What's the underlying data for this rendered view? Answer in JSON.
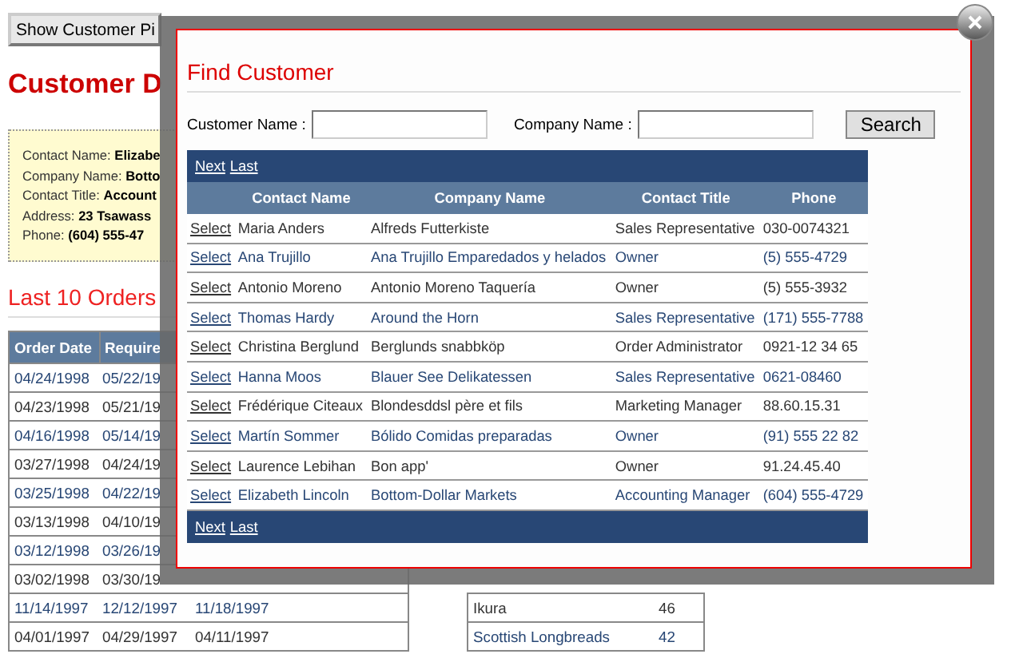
{
  "page": {
    "show_button": "Show Customer Pi",
    "heading": "Customer D",
    "details": [
      {
        "label": "Contact Name:",
        "value": "Elizabe"
      },
      {
        "label": "Company Name:",
        "value": "Botto"
      },
      {
        "label": "Contact Title:",
        "value": "Account"
      },
      {
        "label": "Address:",
        "value": "23 Tsawass"
      },
      {
        "label": "Phone:",
        "value": "(604) 555-47"
      }
    ],
    "orders_title": "Last 10 Orders",
    "orders": {
      "columns": [
        "Order Date",
        "Require"
      ],
      "rows": [
        [
          "04/24/1998",
          "05/22/19"
        ],
        [
          "04/23/1998",
          "05/21/19"
        ],
        [
          "04/16/1998",
          "05/14/19"
        ],
        [
          "03/27/1998",
          "04/24/19"
        ],
        [
          "03/25/1998",
          "04/22/19"
        ],
        [
          "03/13/1998",
          "04/10/19"
        ],
        [
          "03/12/1998",
          "03/26/19"
        ],
        [
          "03/02/1998",
          "03/30/19"
        ],
        [
          "11/14/1997",
          "12/12/1997",
          "11/18/1997"
        ],
        [
          "04/01/1997",
          "04/29/1997",
          "04/11/1997"
        ]
      ]
    },
    "products": {
      "rows": [
        [
          "Ikura",
          "46"
        ],
        [
          "Scottish Longbreads",
          "42"
        ]
      ]
    }
  },
  "dialog": {
    "title": "Find Customer",
    "fields": [
      {
        "label": "Customer Name :"
      },
      {
        "label": "Company Name :"
      }
    ],
    "search_button": "Search",
    "pager": [
      "Next",
      "Last"
    ],
    "columns": [
      "Contact Name",
      "Company Name",
      "Contact Title",
      "Phone"
    ],
    "rows": [
      {
        "action": "Select",
        "contact": "Maria Anders",
        "company": "Alfreds Futterkiste",
        "title": "Sales Representative",
        "phone": "030-0074321"
      },
      {
        "action": "Select",
        "contact": "Ana Trujillo",
        "company": "Ana Trujillo Emparedados y helados",
        "title": "Owner",
        "phone": "(5) 555-4729"
      },
      {
        "action": "Select",
        "contact": "Antonio Moreno",
        "company": "Antonio Moreno Taquería",
        "title": "Owner",
        "phone": "(5) 555-3932"
      },
      {
        "action": "Select",
        "contact": "Thomas Hardy",
        "company": "Around the Horn",
        "title": "Sales Representative",
        "phone": "(171) 555-7788"
      },
      {
        "action": "Select",
        "contact": "Christina Berglund",
        "company": "Berglunds snabbköp",
        "title": "Order Administrator",
        "phone": "0921-12 34 65"
      },
      {
        "action": "Select",
        "contact": "Hanna Moos",
        "company": "Blauer See Delikatessen",
        "title": "Sales Representative",
        "phone": "0621-08460"
      },
      {
        "action": "Select",
        "contact": "Frédérique Citeaux",
        "company": "Blondesddsl père et fils",
        "title": "Marketing Manager",
        "phone": "88.60.15.31"
      },
      {
        "action": "Select",
        "contact": "Martín Sommer",
        "company": "Bólido Comidas preparadas",
        "title": "Owner",
        "phone": "(91) 555 22 82"
      },
      {
        "action": "Select",
        "contact": "Laurence Lebihan",
        "company": "Bon app'",
        "title": "Owner",
        "phone": "91.24.45.40"
      },
      {
        "action": "Select",
        "contact": "Elizabeth Lincoln",
        "company": "Bottom-Dollar Markets",
        "title": "Accounting Manager",
        "phone": "(604) 555-4729"
      }
    ],
    "footer_pager": [
      "Next",
      "Last"
    ]
  }
}
